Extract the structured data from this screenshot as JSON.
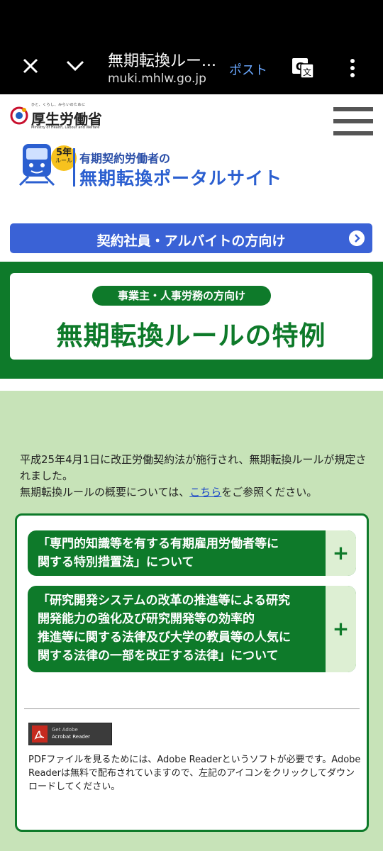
{
  "browser": {
    "title": "無期転換ルー...",
    "url": "muki.mhlw.go.jp",
    "post_label": "ポスト"
  },
  "site": {
    "tagline": "ひと、くらし、みらいのために",
    "ministry_name": "厚生労働省",
    "ministry_en": "Ministry of Health, Labour and Welfare",
    "portal_badge_number": "5年",
    "portal_badge_rule": "ルール",
    "portal_subtitle": "有期契約労働者の",
    "portal_title": "無期転換ポータルサイト"
  },
  "nav": {
    "employee_button": "契約社員・アルバイトの方向け",
    "employer_pill": "事業主・人事労務の方向け",
    "banner_title": "無期転換ルールの特例"
  },
  "content": {
    "intro_line1": "平成25年4月1日に改正労働契約法が施行され、無期転換ルールが規定されました。",
    "intro_line2_before": "無期転換ルールの概要については、",
    "intro_link": "こちら",
    "intro_line2_after": "をご参照ください。",
    "accordion": [
      {
        "title_l1": "「専門的知識等を有する有期雇用労働者等に",
        "title_l2": "関する特別措置法」について"
      },
      {
        "title_l1": "「研究開発システムの改革の推進等による研究",
        "title_l2": "開発能力の強化及び研究開発等の効率的",
        "title_l3": "推進等に関する法律及び大学の教員等の人気に",
        "title_l4": "関する法律の一部を改正する法律」について"
      }
    ],
    "adobe_line1": "Get Adobe",
    "adobe_line2": "Acrobat Reader",
    "pdf_note": "PDFファイルを見るためには、Adobe Readerというソフトが必要です。Adobe Readerは無料で配布されていますので、左記のアイコンをクリックしてダウンロードしてください。"
  },
  "colors": {
    "green": "#0e7a2a",
    "blue_button": "#3a62d6",
    "light_green_bg": "#c7e3b8"
  }
}
